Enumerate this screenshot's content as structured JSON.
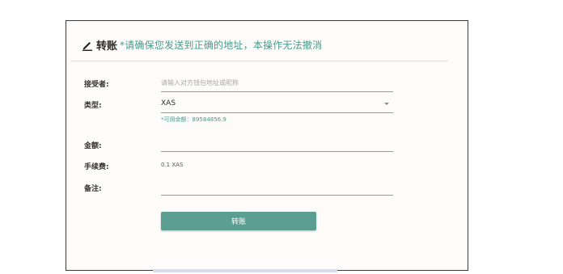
{
  "header": {
    "title": "转账",
    "warning": "*请确保您发送到正确的地址，本操作无法撤消",
    "icon": "pencil-icon"
  },
  "form": {
    "recipient": {
      "label": "接受者:",
      "placeholder": "请输入对方钱包地址或昵称",
      "value": ""
    },
    "type": {
      "label": "类型:",
      "value": "XAS"
    },
    "balance_text": "*可用余额：89584856.9",
    "amount": {
      "label": "金额:",
      "value": ""
    },
    "fee": {
      "label": "手续费:",
      "value": "0.1 XAS"
    },
    "remark": {
      "label": "备注:",
      "value": ""
    }
  },
  "submit_label": "转账",
  "colors": {
    "accent": "#5a9f92",
    "warning_text": "#4a9a8a"
  }
}
